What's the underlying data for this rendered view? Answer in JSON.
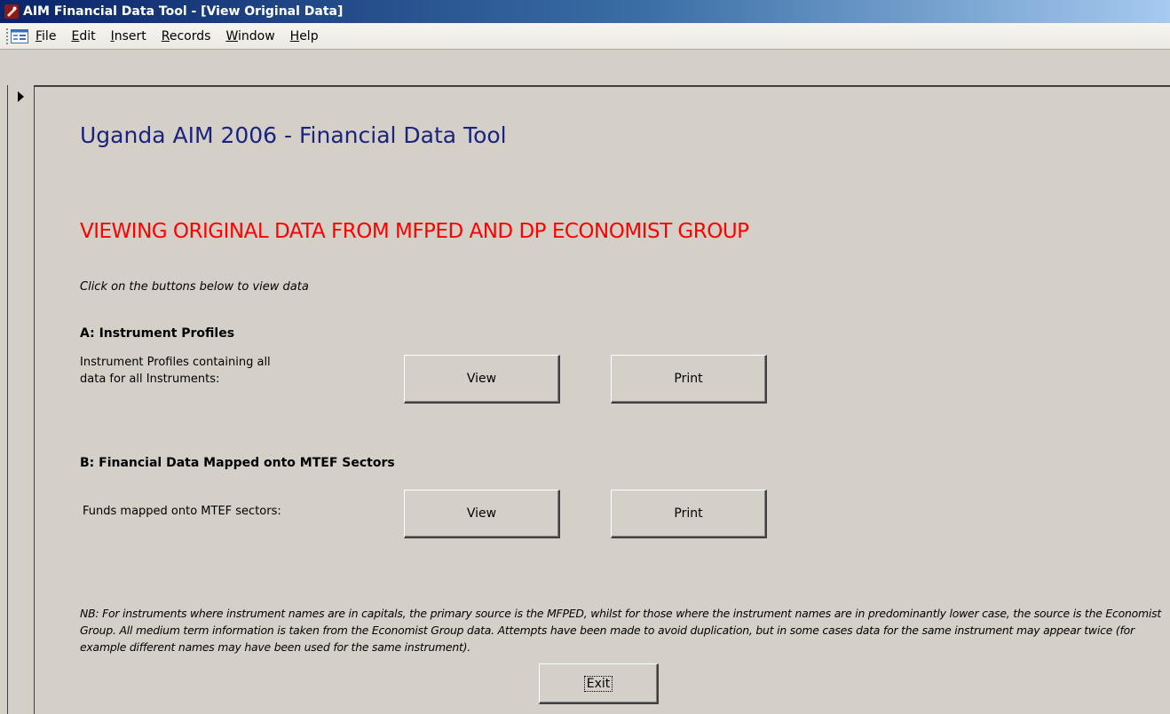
{
  "window": {
    "title": "AIM Financial Data Tool - [View Original Data]"
  },
  "menubar": {
    "items": [
      {
        "label": "File"
      },
      {
        "label": "Edit"
      },
      {
        "label": "Insert"
      },
      {
        "label": "Records"
      },
      {
        "label": "Window"
      },
      {
        "label": "Help"
      }
    ]
  },
  "form": {
    "title": "Uganda AIM 2006 - Financial Data Tool",
    "heading": "VIEWING ORIGINAL DATA FROM MFPED AND DP ECONOMIST GROUP",
    "instruction": "Click on the buttons below to view data",
    "section_a": {
      "heading": "A: Instrument Profiles",
      "label_line1": "Instrument Profiles containing all",
      "label_line2": "data for all Instruments:",
      "view_label": "View",
      "print_label": "Print"
    },
    "section_b": {
      "heading": "B: Financial Data Mapped onto MTEF Sectors",
      "label": "Funds mapped onto MTEF sectors:",
      "view_label": "View",
      "print_label": "Print"
    },
    "note": "NB:  For instruments where instrument names are in capitals, the primary source is the MFPED, whilst for those where the instrument names are in predominantly lower case, the source is the Economist Group.  All medium term information is taken from the Economist Group data.  Attempts have been made to avoid duplication, but in some cases data for the same instrument may appear twice (for example different names may have been used for the same instrument).",
    "exit_label": "Exit"
  },
  "colors": {
    "title_blue": "#1a237e",
    "heading_red": "#ff0000",
    "form_background": "#d4d0c8"
  },
  "icons": {
    "app": "access-key-icon",
    "menu_doc": "form-view-icon",
    "record_selector": "current-record-arrow-icon"
  }
}
